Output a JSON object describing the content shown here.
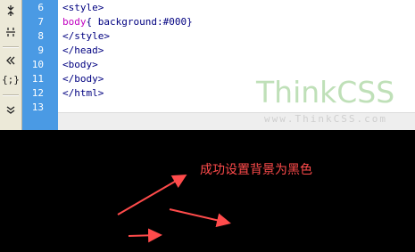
{
  "editor": {
    "toolbar_icons": [
      "collapse-expand-icon",
      "split-arrows-icon",
      "jump-icon",
      "brace-icon",
      "more-chevron-icon"
    ],
    "toolbar_glyphs": [
      "⇹",
      "⇹",
      "≪",
      "{}",
      "»"
    ],
    "lines": [
      {
        "num": "6",
        "text": "<style>"
      },
      {
        "num": "7",
        "selector": "body",
        "rest": "{ background:#000}"
      },
      {
        "num": "8",
        "text": "</style>"
      },
      {
        "num": "9",
        "text": "</head>"
      },
      {
        "num": "10",
        "text": "<body>"
      },
      {
        "num": "11",
        "text": "</body>"
      },
      {
        "num": "12",
        "text": "</html>"
      },
      {
        "num": "13",
        "text": ""
      }
    ]
  },
  "watermark": {
    "brand": "ThinkCSS",
    "url": "www.ThinkCSS.com"
  },
  "output": {
    "background": "#000000",
    "annotation": "成功设置背景为黑色",
    "annotation_color": "#ff4b4b"
  },
  "colors": {
    "gutter": "#4a9ae4",
    "tag": "#000080",
    "selector": "#c000c0"
  }
}
